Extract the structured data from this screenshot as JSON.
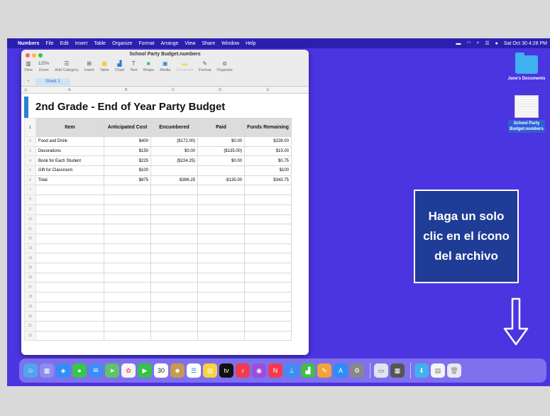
{
  "menubar": {
    "apple": "",
    "items": [
      "Numbers",
      "File",
      "Edit",
      "Insert",
      "Table",
      "Organize",
      "Format",
      "Arrange",
      "View",
      "Share",
      "Window",
      "Help"
    ],
    "clock": "Sat Oct 30  4:28 PM"
  },
  "window": {
    "title": "School Party Budget.numbers",
    "toolbar": [
      {
        "label": "View",
        "icon": "sidebar-icon"
      },
      {
        "label": "Zoom",
        "value": "125%",
        "icon": "zoom-icon"
      },
      {
        "label": "Add Category",
        "icon": "add-category-icon"
      },
      {
        "label": "Insert",
        "icon": "insert-icon"
      },
      {
        "label": "Table",
        "icon": "table-icon"
      },
      {
        "label": "Chart",
        "icon": "chart-icon"
      },
      {
        "label": "Text",
        "icon": "text-icon"
      },
      {
        "label": "Shape",
        "icon": "shape-icon"
      },
      {
        "label": "Media",
        "icon": "media-icon"
      },
      {
        "label": "Comment",
        "icon": "comment-icon"
      },
      {
        "label": "Format",
        "icon": "format-icon"
      },
      {
        "label": "Organize",
        "icon": "organize-icon"
      }
    ],
    "sheet_tab": "Sheet 1",
    "columns": [
      "A",
      "B",
      "C",
      "D",
      "E"
    ]
  },
  "table": {
    "title": "2nd Grade - End of Year Party Budget",
    "headers": [
      "Item",
      "Anticipated Cost",
      "Encumbered",
      "Paid",
      "Funds Remaining"
    ],
    "rows": [
      [
        "Food  and Drink",
        "$400",
        "($172.00)",
        "$0.00",
        "$228.00"
      ],
      [
        "Decorations",
        "$150",
        "$0.00",
        "($135.00)",
        "$15.00"
      ],
      [
        "Book for Each Student",
        "$225",
        "($224.25)",
        "$0.00",
        "$0.75"
      ],
      [
        "Gift for Classroom",
        "$100",
        "",
        "",
        "$100"
      ],
      [
        "Total",
        "$875",
        "-$396.25",
        "-$135.00",
        "$343.75"
      ]
    ],
    "row_count": 22
  },
  "desktop": {
    "folder_label": "Jane's Documents",
    "file_label_line1": "School Party",
    "file_label_line2": "Budget.numbers"
  },
  "callout": {
    "line1": "Haga un solo",
    "line2": "clic en el ícono",
    "line3": "del archivo"
  },
  "dock": {
    "calendar_day": "30",
    "icons": [
      "finder-icon",
      "launchpad-icon",
      "safari-icon",
      "messages-icon",
      "mail-icon",
      "maps-icon",
      "photos-icon",
      "facetime-icon",
      "calendar-icon",
      "contacts-icon",
      "reminders-icon",
      "notes-icon",
      "tv-icon",
      "music-icon",
      "podcasts-icon",
      "news-icon",
      "keynote-icon",
      "numbers-icon",
      "pages-icon",
      "app-store-icon",
      "system-preferences-icon",
      "preview-icon",
      "calculator-icon",
      "downloads-icon",
      "documents-stack-icon",
      "trash-icon"
    ]
  }
}
